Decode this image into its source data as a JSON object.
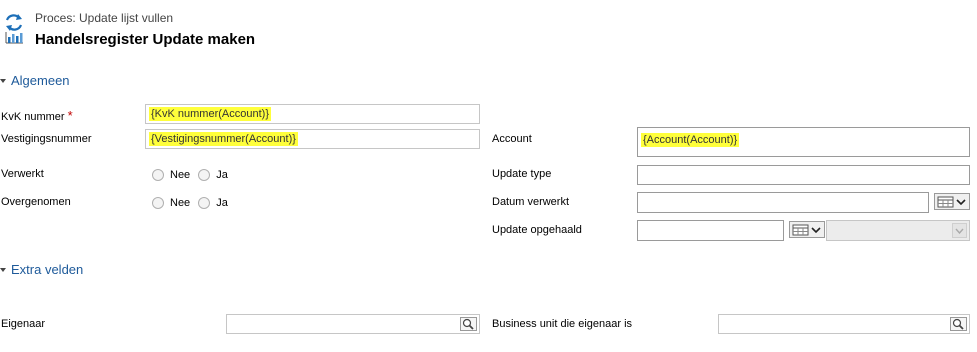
{
  "header": {
    "process_label": "Proces: Update lijst vullen",
    "title": "Handelsregister Update maken"
  },
  "sections": {
    "general": "Algemeen",
    "extra": "Extra velden"
  },
  "fields": {
    "kvk_label": "KvK nummer",
    "kvk_required": "*",
    "kvk_value": "{KvK nummer(Account)}",
    "vestiging_label": "Vestigingsnummer",
    "vestiging_value": "{Vestigingsnummer(Account)}",
    "account_label": "Account",
    "account_value": "{Account(Account)}",
    "verwerkt_label": "Verwerkt",
    "overgenomen_label": "Overgenomen",
    "option_no": "Nee",
    "option_yes": "Ja",
    "update_type_label": "Update type",
    "datum_verwerkt_label": "Datum verwerkt",
    "update_opgehaald_label": "Update opgehaald",
    "eigenaar_label": "Eigenaar",
    "business_unit_label": "Business unit die eigenaar is"
  },
  "colors": {
    "highlight": "#ffff3b",
    "section_link": "#1e5a9a",
    "required": "#c00000"
  },
  "icons": {
    "process": "process-chart-icon",
    "lookup": "lookup-magnifier-icon",
    "calendar": "calendar-icon"
  }
}
